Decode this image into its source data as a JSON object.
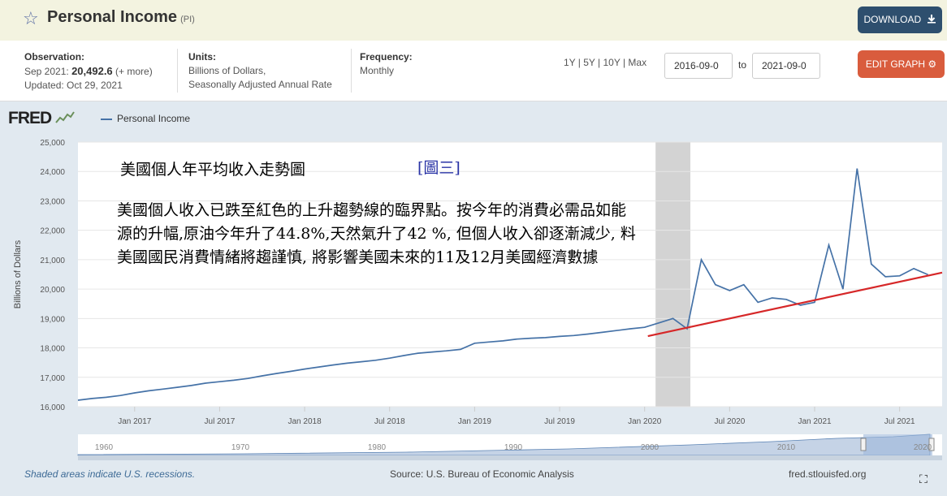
{
  "header": {
    "title": "Personal Income",
    "code": "(PI)",
    "download_label": "DOWNLOAD"
  },
  "info": {
    "observation_label": "Observation:",
    "observation_period": "Sep 2021:",
    "observation_value": "20,492.6",
    "observation_more": "(+ more)",
    "updated": "Updated: Oct 29, 2021",
    "units_label": "Units:",
    "units_line1": "Billions of Dollars,",
    "units_line2": "Seasonally Adjusted Annual Rate",
    "frequency_label": "Frequency:",
    "frequency_value": "Monthly",
    "periods": "1Y | 5Y | 10Y | Max",
    "date_from": "2016-09-0",
    "to_label": "to",
    "date_to": "2021-09-0",
    "edit_graph_label": "EDIT GRAPH"
  },
  "annotations": {
    "title": "美國個人年平均收入走勢圖",
    "ref": "[圖三]",
    "body": "美國個人收入已跌至紅色的上升趨勢線的臨界點。按今年的消費必需品如能源的升幅,原油今年升了44.8%,天然氣升了42 %, 但個人收入卻逐漸減少, 料美國國民消費情緒將趨謹慎, 將影響美國未來的11及12月美國經濟數據"
  },
  "footer": {
    "recession_note": "Shaded areas indicate U.S. recessions.",
    "source": "Source: U.S. Bureau of Economic Analysis",
    "site": "fred.stlouisfed.org"
  },
  "colors": {
    "series": "#4572a7",
    "trendline": "#d62728",
    "recession": "#d3d3d3"
  },
  "icons": {
    "favorite": "star-icon",
    "download": "download-icon",
    "edit": "gear-icon",
    "fullscreen": "fullscreen-icon"
  },
  "chart_data": {
    "type": "line",
    "logo": "FRED",
    "series": [
      {
        "name": "Personal Income",
        "x": [
          "2016-09",
          "2016-10",
          "2016-11",
          "2016-12",
          "2017-01",
          "2017-02",
          "2017-03",
          "2017-04",
          "2017-05",
          "2017-06",
          "2017-07",
          "2017-08",
          "2017-09",
          "2017-10",
          "2017-11",
          "2017-12",
          "2018-01",
          "2018-02",
          "2018-03",
          "2018-04",
          "2018-05",
          "2018-06",
          "2018-07",
          "2018-08",
          "2018-09",
          "2018-10",
          "2018-11",
          "2018-12",
          "2019-01",
          "2019-02",
          "2019-03",
          "2019-04",
          "2019-05",
          "2019-06",
          "2019-07",
          "2019-08",
          "2019-09",
          "2019-10",
          "2019-11",
          "2019-12",
          "2020-01",
          "2020-02",
          "2020-03",
          "2020-04",
          "2020-05",
          "2020-06",
          "2020-07",
          "2020-08",
          "2020-09",
          "2020-10",
          "2020-11",
          "2020-12",
          "2021-01",
          "2021-02",
          "2021-03",
          "2021-04",
          "2021-05",
          "2021-06",
          "2021-07",
          "2021-08",
          "2021-09"
        ],
        "values": [
          16220,
          16280,
          16320,
          16380,
          16470,
          16540,
          16600,
          16660,
          16720,
          16800,
          16850,
          16900,
          16960,
          17050,
          17130,
          17200,
          17280,
          17350,
          17420,
          17480,
          17530,
          17580,
          17650,
          17740,
          17820,
          17860,
          17900,
          17950,
          18160,
          18200,
          18240,
          18300,
          18330,
          18350,
          18390,
          18420,
          18470,
          18530,
          18590,
          18650,
          18700,
          18850,
          19000,
          18650,
          21000,
          20150,
          19950,
          20150,
          19550,
          19700,
          19650,
          19450,
          19550,
          21500,
          20000,
          24100,
          20850,
          20420,
          20450,
          20700,
          20490
        ]
      }
    ],
    "trendline": {
      "x": [
        "2020-01",
        "2021-09"
      ],
      "values": [
        18400,
        20450
      ]
    },
    "recession": [
      "2020-02",
      "2020-04"
    ],
    "x_ticks": [
      {
        "x": "2017-01",
        "label": "Jan 2017"
      },
      {
        "x": "2017-07",
        "label": "Jul 2017"
      },
      {
        "x": "2018-01",
        "label": "Jan 2018"
      },
      {
        "x": "2018-07",
        "label": "Jul 2018"
      },
      {
        "x": "2019-01",
        "label": "Jan 2019"
      },
      {
        "x": "2019-07",
        "label": "Jul 2019"
      },
      {
        "x": "2020-01",
        "label": "Jan 2020"
      },
      {
        "x": "2020-07",
        "label": "Jul 2020"
      },
      {
        "x": "2021-01",
        "label": "Jan 2021"
      },
      {
        "x": "2021-07",
        "label": "Jul 2021"
      }
    ],
    "y_ticks": [
      16000,
      17000,
      18000,
      19000,
      20000,
      21000,
      22000,
      23000,
      24000,
      25000
    ],
    "y_tick_labels": [
      "16,000",
      "17,000",
      "18,000",
      "19,000",
      "20,000",
      "21,000",
      "22,000",
      "23,000",
      "24,000",
      "25,000"
    ],
    "ylim": [
      16000,
      25000
    ],
    "xlim": [
      "2016-09",
      "2021-10"
    ],
    "ylabel": "Billions of Dollars",
    "grid": true,
    "legend_position": "top-left",
    "navigator_labels": [
      "1960",
      "1970",
      "1980",
      "1990",
      "2000",
      "2010",
      "2020"
    ]
  }
}
